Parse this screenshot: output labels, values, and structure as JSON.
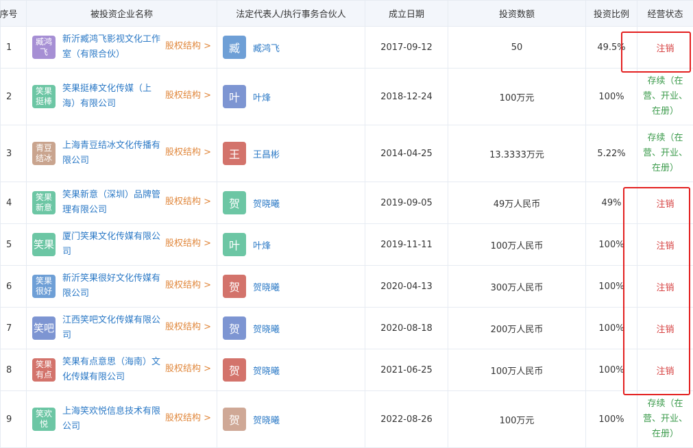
{
  "headers": [
    "序号",
    "被投资企业名称",
    "法定代表人/执行事务合伙人",
    "成立日期",
    "投资数额",
    "投资比例",
    "经营状态"
  ],
  "equity_link_label": "股权结构 >",
  "rows": [
    {
      "idx": "1",
      "logo_text": "臧鸿飞",
      "logo_color": "#a68fd4",
      "company": "新沂臧鸿飞影视文化工作室（有限合伙）",
      "avatar_char": "臧",
      "avatar_color": "#6e9fd6",
      "rep": "臧鸿飞",
      "date": "2017-09-12",
      "amount": "50",
      "ratio": "49.5%",
      "status": "注销",
      "status_type": "cancel"
    },
    {
      "idx": "2",
      "logo_text": "笑果挺棒",
      "logo_color": "#6cc6a4",
      "company": "笑果挺棒文化传媒（上海）有限公司",
      "avatar_char": "叶",
      "avatar_color": "#7d95d2",
      "rep": "叶烽",
      "date": "2018-12-24",
      "amount": "100万元",
      "ratio": "100%",
      "status": "存续（在营、开业、在册）",
      "status_type": "active"
    },
    {
      "idx": "3",
      "logo_text": "青豆结冰",
      "logo_color": "#c9a48e",
      "company": "上海青豆结冰文化传播有限公司",
      "avatar_char": "王",
      "avatar_color": "#d3736b",
      "rep": "王昌彬",
      "date": "2014-04-25",
      "amount": "13.3333万元",
      "ratio": "5.22%",
      "status": "存续（在营、开业、在册）",
      "status_type": "active"
    },
    {
      "idx": "4",
      "logo_text": "笑果新意",
      "logo_color": "#6cc6a4",
      "company": "笑果新意（深圳）品牌管理有限公司",
      "avatar_char": "贺",
      "avatar_color": "#6cc6a4",
      "rep": "贺晓曦",
      "date": "2019-09-05",
      "amount": "49万人民币",
      "ratio": "49%",
      "status": "注销",
      "status_type": "cancel"
    },
    {
      "idx": "5",
      "logo_text": "笑果",
      "logo_color": "#6cc6a4",
      "company": "厦门笑果文化传媒有限公司",
      "avatar_char": "叶",
      "avatar_color": "#6cc6a4",
      "rep": "叶烽",
      "date": "2019-11-11",
      "amount": "100万人民币",
      "ratio": "100%",
      "status": "注销",
      "status_type": "cancel"
    },
    {
      "idx": "6",
      "logo_text": "笑果很好",
      "logo_color": "#6e9fd6",
      "company": "新沂笑果很好文化传媒有限公司",
      "avatar_char": "贺",
      "avatar_color": "#d3736b",
      "rep": "贺晓曦",
      "date": "2020-04-13",
      "amount": "300万人民币",
      "ratio": "100%",
      "status": "注销",
      "status_type": "cancel"
    },
    {
      "idx": "7",
      "logo_text": "笑吧",
      "logo_color": "#7d95d2",
      "company": "江西笑吧文化传媒有限公司",
      "avatar_char": "贺",
      "avatar_color": "#7d95d2",
      "rep": "贺晓曦",
      "date": "2020-08-18",
      "amount": "200万人民币",
      "ratio": "100%",
      "status": "注销",
      "status_type": "cancel"
    },
    {
      "idx": "8",
      "logo_text": "笑果有点",
      "logo_color": "#d3736b",
      "company": "笑果有点意思（海南）文化传媒有限公司",
      "avatar_char": "贺",
      "avatar_color": "#d3736b",
      "rep": "贺晓曦",
      "date": "2021-06-25",
      "amount": "100万人民币",
      "ratio": "100%",
      "status": "注销",
      "status_type": "cancel"
    },
    {
      "idx": "9",
      "logo_text": "笑欢悦",
      "logo_color": "#6cc6a4",
      "company": "上海笑欢悦信息技术有限公司",
      "avatar_char": "贺",
      "avatar_color": "#cfa896",
      "rep": "贺晓曦",
      "date": "2022-08-26",
      "amount": "100万元",
      "ratio": "100%",
      "status": "存续（在营、开业、在册）",
      "status_type": "active"
    }
  ]
}
